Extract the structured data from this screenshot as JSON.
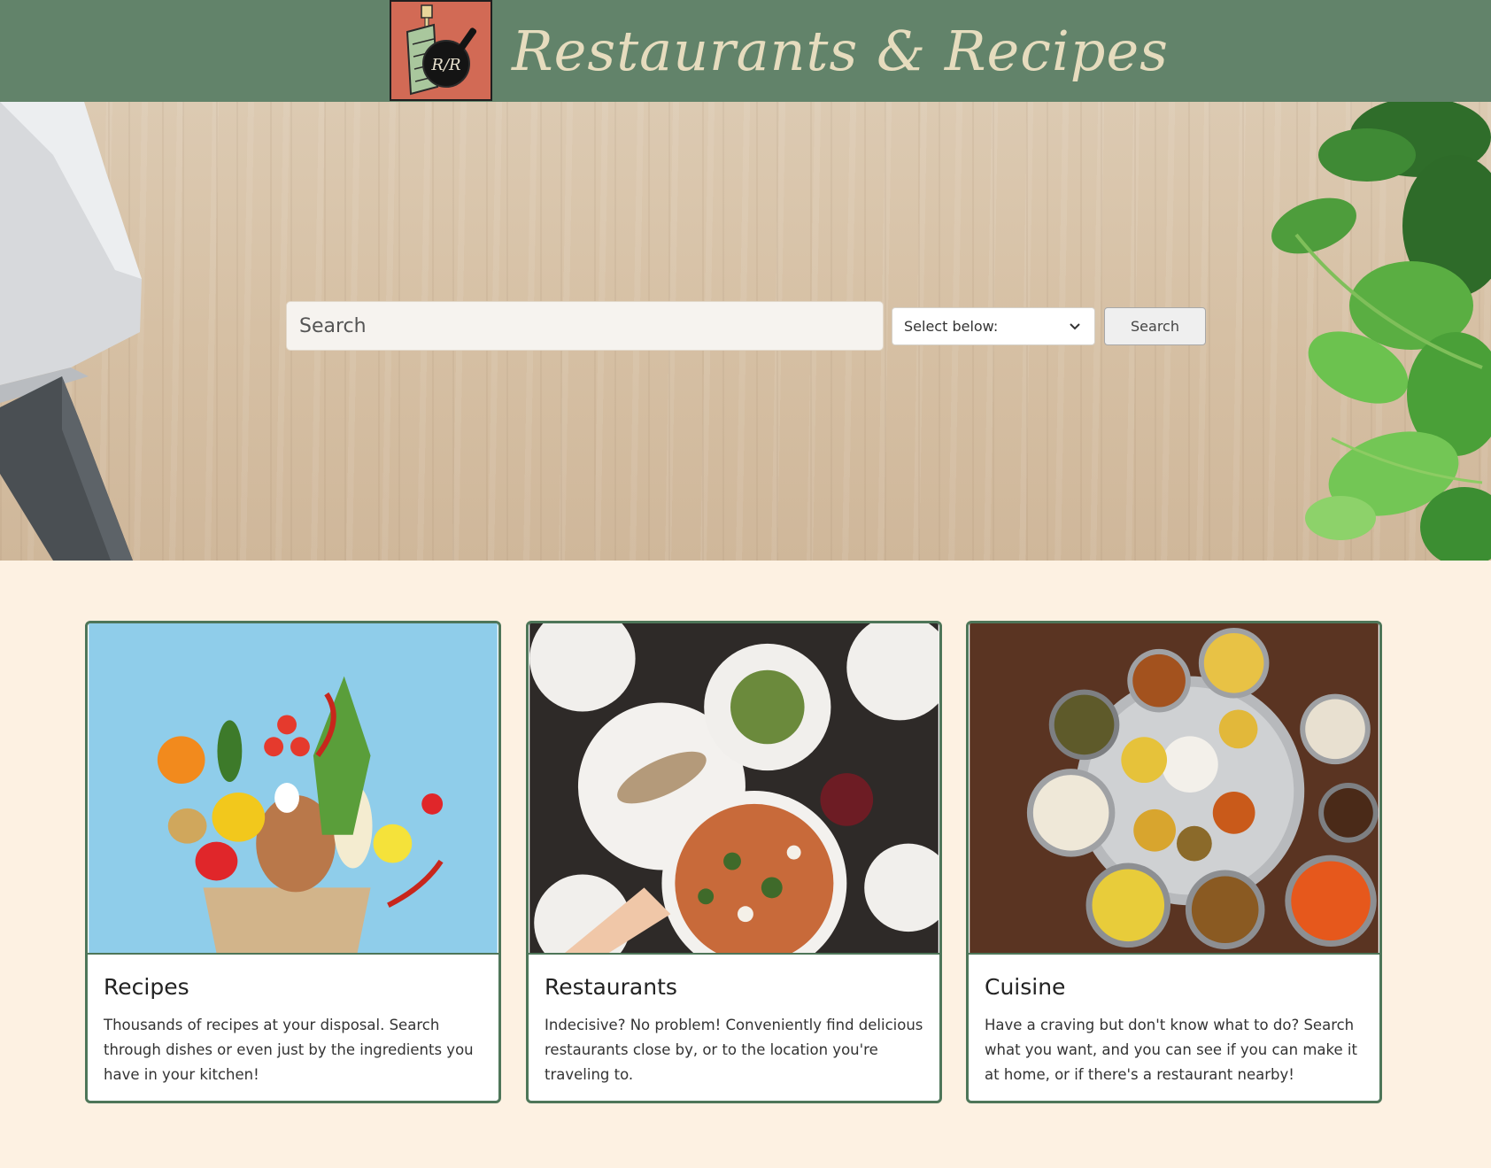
{
  "header": {
    "brand_title": "Restaurants & Recipes",
    "logo_text": "R/R",
    "colors": {
      "bar": "#62836a",
      "logo_bg": "#d26a55",
      "title": "#e6dcbe"
    }
  },
  "search": {
    "placeholder": "Search",
    "select_label": "Select below:",
    "button_label": "Search"
  },
  "cards": [
    {
      "title": "Recipes",
      "text": "Thousands of recipes at your disposal. Search through dishes or even just by the ingredients you have in your kitchen!"
    },
    {
      "title": "Restaurants",
      "text": "Indecisive? No problem! Conveniently find delicious restaurants close by, or to the location you're traveling to."
    },
    {
      "title": "Cuisine",
      "text": "Have a craving but don't know what to do? Search what you want, and you can see if you can make it at home, or if there's a restaurant nearby!"
    }
  ],
  "theme": {
    "page_bg": "#fdf1e2",
    "card_border": "#4e7659"
  }
}
